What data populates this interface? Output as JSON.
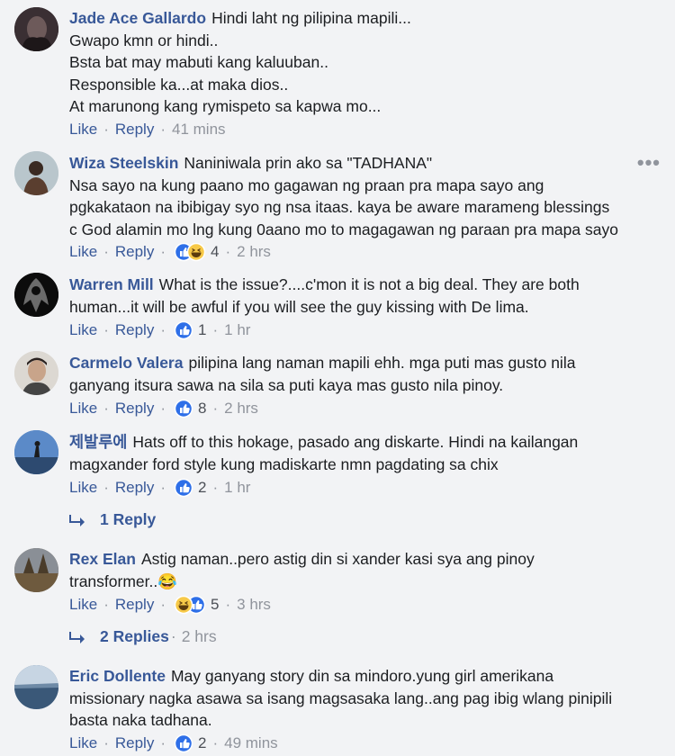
{
  "comments": [
    {
      "name": "Jade Ace Gallardo",
      "lines": [
        "Hindi laht ng pilipina mapili...",
        "Gwapo kmn or hindi..",
        "Bsta bat may mabuti kang kaluuban..",
        "Responsible ka...at maka dios..",
        "At marunong kang rymispeto sa kapwa mo..."
      ],
      "like": "Like",
      "reply": "Reply",
      "time": "41 mins"
    },
    {
      "name": "Wiza Steelskin",
      "lines": [
        "Naniniwala prin ako sa \"TADHANA\"",
        "Nsa sayo na kung paano mo gagawan ng praan pra mapa sayo ang",
        "pgkakataon na ibibigay syo ng nsa itaas. kaya be aware marameng blessings",
        "c God alamin mo lng kung 0aano mo to magagawan ng paraan pra mapa sayo"
      ],
      "like": "Like",
      "reply": "Reply",
      "reactions": [
        "like",
        "haha"
      ],
      "count": "4",
      "time": "2 hrs"
    },
    {
      "name": "Warren Mill",
      "lines": [
        "What is the issue?....c'mon it is not a big deal. They are both",
        "human...it will be awful if you will see the guy kissing with De lima."
      ],
      "like": "Like",
      "reply": "Reply",
      "reactions": [
        "like"
      ],
      "count": "1",
      "time": "1 hr"
    },
    {
      "name": "Carmelo Valera",
      "lines": [
        "pilipina lang naman mapili ehh. mga puti mas gusto nila",
        "ganyang itsura sawa na sila sa puti kaya mas gusto nila pinoy."
      ],
      "like": "Like",
      "reply": "Reply",
      "reactions": [
        "like"
      ],
      "count": "8",
      "time": "2 hrs"
    },
    {
      "name": "제발루에",
      "lines": [
        "Hats off to this hokage, pasado ang diskarte. Hindi na kailangan",
        "magxander ford style kung madiskarte nmn pagdating sa chix"
      ],
      "like": "Like",
      "reply": "Reply",
      "reactions": [
        "like"
      ],
      "count": "2",
      "time": "1 hr",
      "replies": "1 Reply"
    },
    {
      "name": "Rex Elan",
      "lines": [
        "Astig naman..pero astig din si xander kasi sya ang pinoy",
        "transformer..😂"
      ],
      "like": "Like",
      "reply": "Reply",
      "reactions": [
        "haha",
        "like"
      ],
      "count": "5",
      "time": "3 hrs",
      "replies": "2 Replies",
      "replies_time": "2 hrs"
    },
    {
      "name": "Eric Dollente",
      "lines": [
        "May ganyang story din sa mindoro.yung girl amerikana",
        "missionary nagka asawa sa isang magsasaka lang..ang pag ibig wlang pinipili",
        "basta naka tadhana."
      ],
      "like": "Like",
      "reply": "Reply",
      "reactions": [
        "like"
      ],
      "count": "2",
      "time": "49 mins"
    }
  ],
  "more_options": "•••",
  "colors": {
    "link": "#385898",
    "meta": "#90949c",
    "background": "#f2f3f5",
    "like_blue": "#2e6fe8",
    "haha_yellow": "#f7c948"
  },
  "icons": [
    "reply-arrow-icon",
    "like-reaction-icon",
    "haha-reaction-icon",
    "more-options-icon"
  ]
}
